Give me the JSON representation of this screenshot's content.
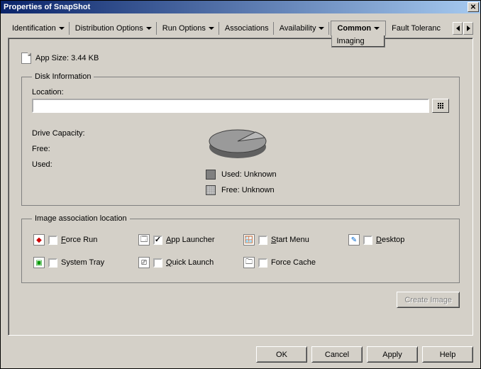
{
  "window": {
    "title": "Properties of SnapShot"
  },
  "tabs": {
    "t0": "Identification",
    "t1": "Distribution Options",
    "t2": "Run Options",
    "t3": "Associations",
    "t4": "Availability",
    "t5": "Common",
    "t5_sub": "Imaging",
    "t6": "Fault Toleranc"
  },
  "app_size": {
    "label": "App Size: 3.44 KB"
  },
  "disk": {
    "legend": "Disk Information",
    "location_label": "Location:",
    "location_value": "",
    "drive_capacity": "Drive Capacity:",
    "free": "Free:",
    "used": "Used:",
    "legend_used": "Used: Unknown",
    "legend_free": "Free: Unknown"
  },
  "assoc": {
    "legend": "Image association location",
    "force_run": "Force Run",
    "app_launcher": "App Launcher",
    "start_menu": "Start Menu",
    "desktop": "Desktop",
    "system_tray": "System Tray",
    "quick_launch": "Quick Launch",
    "force_cache": "Force Cache"
  },
  "buttons": {
    "create_image": "Create Image",
    "ok": "OK",
    "cancel": "Cancel",
    "apply": "Apply",
    "help": "Help"
  },
  "chart_data": {
    "type": "pie",
    "title": "Disk usage",
    "series": [
      {
        "name": "Used",
        "value": null,
        "label": "Unknown",
        "color": "#808080"
      },
      {
        "name": "Free",
        "value": null,
        "label": "Unknown",
        "color": "#c0c0c0"
      }
    ]
  }
}
